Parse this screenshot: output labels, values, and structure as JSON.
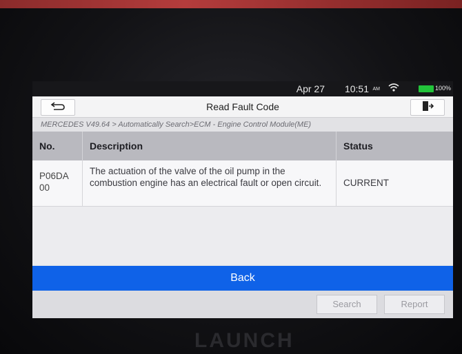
{
  "status_bar": {
    "date": "Apr 27",
    "time": "10:51",
    "ampm": "AM",
    "battery": "100%"
  },
  "header": {
    "title": "Read Fault Code"
  },
  "breadcrumb": "MERCEDES V49.64 > Automatically Search>ECM - Engine Control Module(ME)",
  "table": {
    "columns": [
      "No.",
      "Description",
      "Status"
    ],
    "rows": [
      {
        "code": "P06DA 00",
        "description": "The actuation of the valve of the oil pump in the combustion engine has an electrical fault or open circuit.",
        "status": "CURRENT"
      }
    ]
  },
  "actions": {
    "back": "Back",
    "search": "Search",
    "report": "Report"
  },
  "device": {
    "brand": "LAUNCH"
  },
  "colors": {
    "accent": "#0f62e8",
    "battery": "#22c33a"
  },
  "icons": [
    "back-arrow-icon",
    "exit-icon",
    "wifi-icon"
  ]
}
